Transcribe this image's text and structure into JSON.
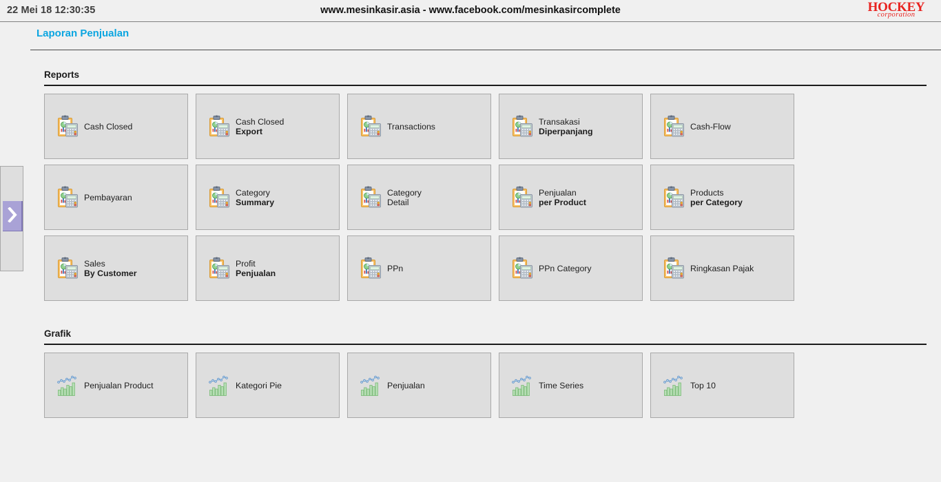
{
  "topbar": {
    "clock": "22 Mei 18 12:30:35",
    "center_text": "www.mesinkasir.asia - www.facebook.com/mesinkasircomplete",
    "brand_main": "HOCKEY",
    "brand_sub": "corporation"
  },
  "page": {
    "title": "Laporan Penjualan"
  },
  "rail": {
    "toggle_label": "expand-sidebar"
  },
  "sections": [
    {
      "title": "Reports",
      "icon": "report-clipboard-calculator-icon",
      "cards": [
        {
          "line1": "Cash Closed",
          "line2": "",
          "line2_bold": false
        },
        {
          "line1": "Cash Closed",
          "line2": "Export",
          "line2_bold": true
        },
        {
          "line1": "Transactions",
          "line2": "",
          "line2_bold": false
        },
        {
          "line1": "Transakasi",
          "line2": "Diperpanjang",
          "line2_bold": true
        },
        {
          "line1": "Cash-Flow",
          "line2": "",
          "line2_bold": false
        },
        {
          "line1": "Pembayaran",
          "line2": "",
          "line2_bold": false
        },
        {
          "line1": "Category",
          "line2": "Summary",
          "line2_bold": true
        },
        {
          "line1": "Category",
          "line2": "Detail",
          "line2_bold": false
        },
        {
          "line1": "Penjualan",
          "line2": "per Product",
          "line2_bold": true
        },
        {
          "line1": "Products",
          "line2": "per Category",
          "line2_bold": true
        },
        {
          "line1": "Sales",
          "line2": "By Customer",
          "line2_bold": true
        },
        {
          "line1": "Profit",
          "line2": "Penjualan",
          "line2_bold": true
        },
        {
          "line1": "PPn",
          "line2": "",
          "line2_bold": false
        },
        {
          "line1": "PPn Category",
          "line2": "",
          "line2_bold": false
        },
        {
          "line1": "Ringkasan Pajak",
          "line2": "",
          "line2_bold": false
        }
      ]
    },
    {
      "title": "Grafik",
      "icon": "chart-bars-line-icon",
      "cards": [
        {
          "line1": "Penjualan Product",
          "line2": "",
          "line2_bold": false
        },
        {
          "line1": "Kategori Pie",
          "line2": "",
          "line2_bold": false
        },
        {
          "line1": "Penjualan",
          "line2": "",
          "line2_bold": false
        },
        {
          "line1": "Time Series",
          "line2": "",
          "line2_bold": false
        },
        {
          "line1": "Top 10",
          "line2": "",
          "line2_bold": false
        }
      ]
    }
  ],
  "colors": {
    "page_bg": "#f0f0f0",
    "card_bg": "#dedede",
    "card_border": "#a8a8a8",
    "title_accent": "#0aa5e0",
    "brand_red": "#e8221f",
    "rail_toggle": "#a9a2d6"
  }
}
